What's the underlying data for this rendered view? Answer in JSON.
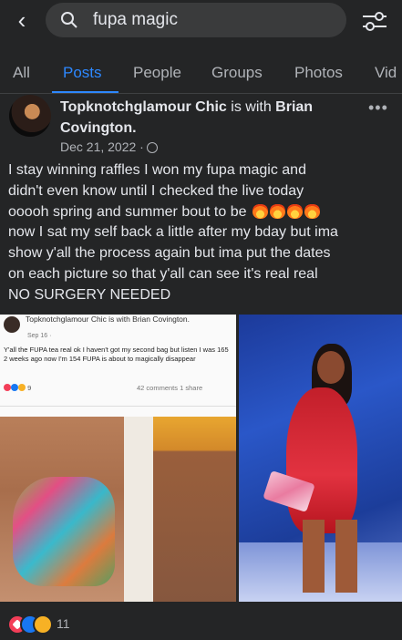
{
  "search": {
    "query": "fupa magic"
  },
  "tabs": [
    {
      "label": "All"
    },
    {
      "label": "Posts"
    },
    {
      "label": "People"
    },
    {
      "label": "Groups"
    },
    {
      "label": "Photos"
    },
    {
      "label": "Vid"
    }
  ],
  "post": {
    "author": "Topknotchglamour Chic",
    "with_text": "is with",
    "tagged": "Brian Covington.",
    "date": "Dec 21, 2022 ·",
    "text_lines": [
      "I stay winning raffles I won my fupa magic and",
      "didn't even know until I checked the live today",
      "ooooh spring and summer bout to be",
      "now I sat my self back a little after my bday but ima",
      "show y'all the process again but ima put the dates",
      "on each picture so that y'all can see it's real real",
      "NO SURGERY NEEDED"
    ],
    "reaction_count": "11"
  },
  "inner_post": {
    "author": "Topknotchglamour Chic is with Brian Covington.",
    "date": "Sep 16 ·",
    "text": "Y'all the FUPA tea real ok I haven't got my second bag but listen I was 165 2 weeks ago now I'm 154 FUPA is about to magically disappear",
    "reacts": "9",
    "stats": "42 comments   1 share"
  },
  "colors": {
    "accent": "#2d88ff",
    "background": "#242526",
    "text": "#e4e6eb",
    "muted": "#b0b3b8"
  },
  "icons": [
    "back-arrow-icon",
    "search-icon",
    "filter-icon",
    "more-icon",
    "globe-icon",
    "fire-emoji-icon",
    "love-reaction-icon",
    "like-reaction-icon",
    "care-reaction-icon"
  ]
}
